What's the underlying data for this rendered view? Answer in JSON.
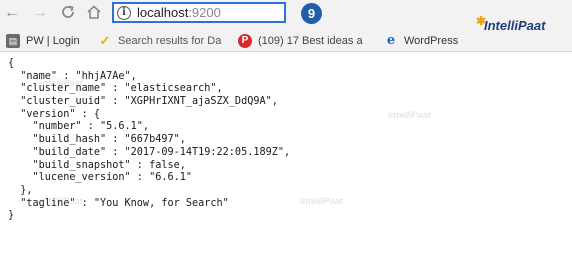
{
  "browser": {
    "address": {
      "host": "localhost",
      "port": ":9200"
    },
    "step_badge": "9"
  },
  "logo": {
    "text": "IntelliPaat"
  },
  "bookmarks": [
    {
      "label": "PW | Login",
      "icon": "folder-icon"
    },
    {
      "label": "Search results for Da",
      "icon": "checkmark-logo-icon"
    },
    {
      "label": "(109) 17 Best ideas a",
      "icon": "pinterest-icon"
    },
    {
      "label": "WordPress",
      "icon": "e-logo-icon"
    }
  ],
  "json_lines": [
    "{",
    "  \"name\" : \"hhjA7Ae\",",
    "  \"cluster_name\" : \"elasticsearch\",",
    "  \"cluster_uuid\" : \"XGPHrIXNT_ajaSZX_DdQ9A\",",
    "  \"version\" : {",
    "    \"number\" : \"5.6.1\",",
    "    \"build_hash\" : \"667b497\",",
    "    \"build_date\" : \"2017-09-14T19:22:05.189Z\",",
    "    \"build_snapshot\" : false,",
    "    \"lucene_version\" : \"6.6.1\"",
    "  },",
    "  \"tagline\" : \"You Know, for Search\"",
    "}"
  ]
}
